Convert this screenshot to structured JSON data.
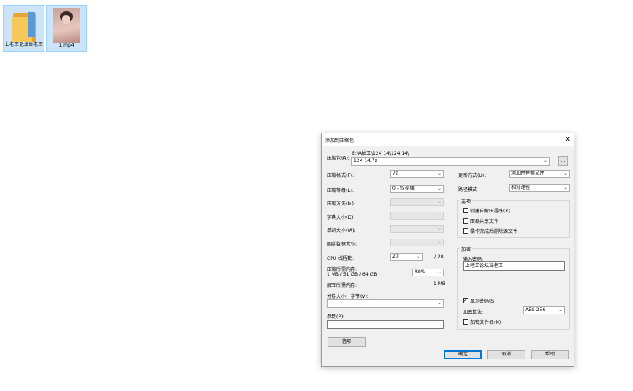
{
  "desktop": {
    "icons": [
      {
        "label": "上老王论坛当老王",
        "type": "folder"
      },
      {
        "label": "1.mp4",
        "type": "video"
      }
    ]
  },
  "dialog": {
    "title": "添加到压缩包",
    "close_glyph": "✕",
    "archive": {
      "label": "压缩包(A):",
      "path": "E:\\A抽工\\124 14\\124 14\\",
      "filename": "124 14.7z",
      "browse_label": "..."
    },
    "left": {
      "format_label": "压缩格式(F):",
      "format_value": "7z",
      "level_label": "压缩等级(L):",
      "level_value": "0 - 仅存储",
      "method_label": "压缩方法(M):",
      "dict_label": "字典大小(D):",
      "word_label": "单词大小(W):",
      "solid_label": "固实数据大小:",
      "cpu_label": "CPU 线程数:",
      "cpu_value": "20",
      "cpu_total": "/ 20",
      "mem_label": "压缩所需内存:",
      "mem_detail": "1 MB / 51 GB / 64 GB",
      "mem_pct": "80%",
      "decomp_label": "解压所需内存:",
      "decomp_value": "1 MB",
      "split_label": "分卷大小，字节(V):",
      "params_label": "参数(P):",
      "options_button": "选项"
    },
    "right": {
      "update_label": "更新方式(U):",
      "update_value": "添加并替换文件",
      "path_label": "路径模式",
      "path_value": "相对路径",
      "options_group": "选项",
      "opt_sfx": "创建自解压程序(X)",
      "opt_shared": "压缩共享文件",
      "opt_delete": "操作完成后删除源文件",
      "enc_group": "加密",
      "pwd_label": "输入密码:",
      "pwd_value": "上老王论坛当老王",
      "show_pwd": "显示密码(S)",
      "enc_method_label": "加密算法:",
      "enc_method_value": "AES-256",
      "enc_names": "加密文件名(N)"
    },
    "buttons": {
      "ok": "确定",
      "cancel": "取消",
      "help": "帮助"
    },
    "checked_glyph": "✓",
    "arrow_glyph": "⌄"
  }
}
